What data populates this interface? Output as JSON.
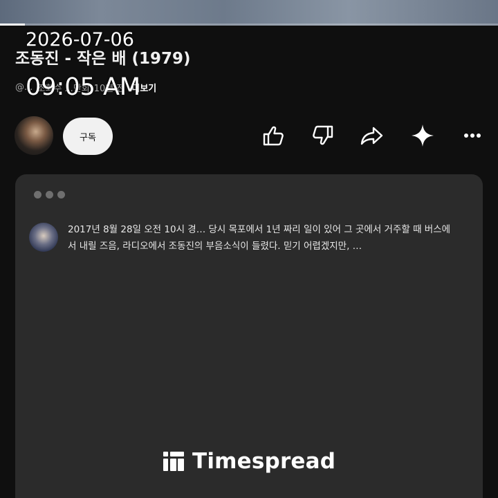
{
  "overlay": {
    "date": "2026-07-06",
    "time": "09:05 AM"
  },
  "player": {
    "progress_fraction": 0.05
  },
  "video": {
    "title": "조동진 - 작은 배 (1979)",
    "channel": "@...",
    "views": "조회수 ...만회",
    "age": "10년 전",
    "more_label": "더보기"
  },
  "actions": {
    "subscribe_label": "구독",
    "icons": [
      "like-icon",
      "dislike-icon",
      "share-icon",
      "sparkle-icon",
      "more-icon"
    ]
  },
  "comments": {
    "text": "2017년 8월 28일 오전 10시 경… 당시 목포에서 1년 짜리 일이 있어 그 곳에서 거주할 때 버스에서 내릴 즈음, 라디오에서 조동진의 부음소식이 들렸다. 믿기 어렵겠지만, …"
  },
  "brand": {
    "name": "Timespread",
    "logo_icon": "timespread-logo-icon"
  },
  "colors": {
    "background": "#0f0f0f",
    "card": "#2b2b2b",
    "subscribe_bg": "#f1f1f1",
    "text_primary": "#f1f1f1",
    "text_secondary": "#aaaaaa"
  }
}
